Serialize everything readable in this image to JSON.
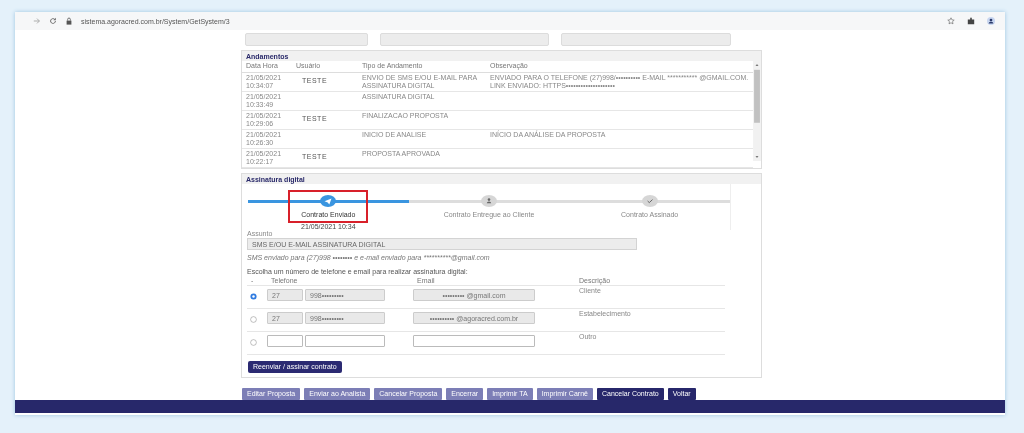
{
  "browser": {
    "url": "sistema.agoracred.com.br/System/GetSystem/3"
  },
  "andamentos": {
    "title": "Andamentos",
    "columns": [
      "Data Hora",
      "Usuário",
      "Tipo de Andamento",
      "Observação"
    ],
    "rows": [
      {
        "datetime": "21/05/2021 10:34:07",
        "user": "TESTE",
        "type": "ENVIO DE SMS E/OU E-MAIL PARA ASSINATURA DIGITAL",
        "note": "ENVIADO PARA O TELEFONE (27)998/•••••••••• E-MAIL *********** @GMAIL.COM. LINK ENVIADO: HTTPS••••••••••••••••••••"
      },
      {
        "datetime": "21/05/2021 10:33:49",
        "type": "ASSINATURA DIGITAL"
      },
      {
        "datetime": "21/05/2021 10:29:06",
        "user": "TESTE",
        "type": "FINALIZACAO PROPOSTA"
      },
      {
        "datetime": "21/05/2021 10:26:30",
        "type": "INICIO DE ANALISE",
        "note": "INÍCIO DA ANÁLISE DA PROPOSTA"
      },
      {
        "datetime": "21/05/2021 10:22:17",
        "user": "TESTE",
        "type": "PROPOSTA APROVADA"
      }
    ]
  },
  "assinatura": {
    "title": "Assinatura digital",
    "steps": [
      {
        "kind": "sent",
        "label": "Contrato Enviado",
        "done": true,
        "highlighted": true,
        "date": "21/05/2021 10:34"
      },
      {
        "kind": "delivered",
        "label": "Contrato Entregue ao Cliente",
        "done": false,
        "highlighted": false
      },
      {
        "kind": "signed",
        "label": "Contrato Assinado",
        "done": false,
        "highlighted": false
      }
    ],
    "subject_label": "Assunto",
    "subject": "SMS E/OU E-MAIL ASSINATURA DIGITAL",
    "sms_note": "SMS enviado para (27)998 •••••••• e e-mail enviado para **********@gmail.com",
    "prompt": "Escolha um número de telefone e email para realizar assinatura digital:",
    "contact_columns": [
      "-",
      "Telefone",
      "Email",
      "Descrição"
    ],
    "contacts": [
      {
        "selected": true,
        "editable": false,
        "ddd": "27",
        "phone": "998•••••••••",
        "email": "••••••••• @gmail.com",
        "description": "Cliente"
      },
      {
        "selected": false,
        "editable": false,
        "ddd": "27",
        "phone": "998•••••••••",
        "email": "•••••••••• @agoracred.com.br",
        "description": "Estabelecimento"
      },
      {
        "selected": false,
        "editable": true,
        "description": "Outro"
      }
    ],
    "resend_button": "Reenviar / assinar contrato"
  },
  "actions": [
    {
      "label": "Editar Proposta",
      "kind": "secondary"
    },
    {
      "label": "Enviar ao Analista",
      "kind": "secondary"
    },
    {
      "label": "Cancelar Proposta",
      "kind": "secondary"
    },
    {
      "label": "Encerrar",
      "kind": "secondary"
    },
    {
      "label": "Imprimir TA",
      "kind": "secondary"
    },
    {
      "label": "Imprimir Carnê",
      "kind": "secondary"
    },
    {
      "label": "Cancelar Contrato",
      "kind": "primary"
    },
    {
      "label": "Voltar",
      "kind": "primary"
    }
  ]
}
